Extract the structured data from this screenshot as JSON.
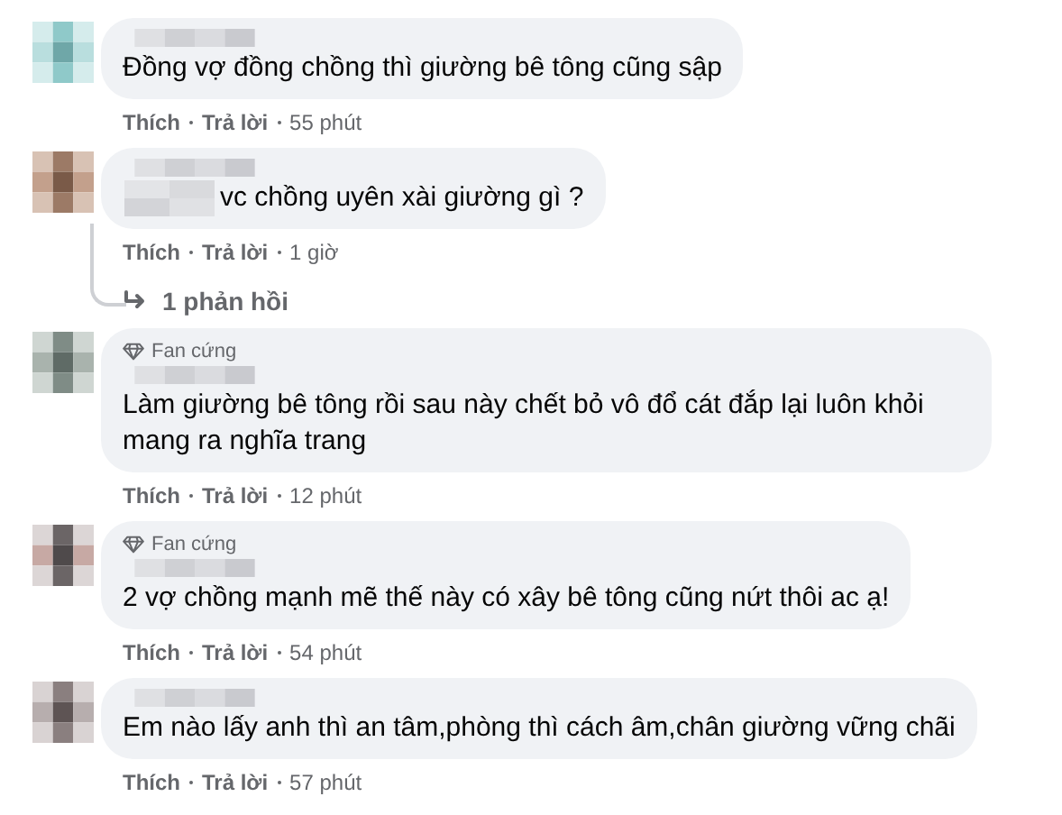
{
  "comments": [
    {
      "text": "Đồng vợ đồng chồng thì giường bê tông cũng sập",
      "text_blurred_prefix": false,
      "like": "Thích",
      "reply": "Trả lời",
      "time": "55 phút"
    },
    {
      "text": "vc chồng uyên xài giường gì ?",
      "text_blurred_prefix": true,
      "like": "Thích",
      "reply": "Trả lời",
      "time": "1 giờ",
      "replies": "1 phản hồi"
    },
    {
      "badge": "Fan cứng",
      "text": "Làm giường bê tông rồi sau này chết bỏ vô đổ cát đắp lại luôn khỏi mang ra nghĩa trang",
      "text_blurred_prefix": false,
      "like": "Thích",
      "reply": "Trả lời",
      "time": "12 phút"
    },
    {
      "badge": "Fan cứng",
      "text": "2 vợ chồng mạnh mẽ thế này có xây bê tông cũng nứt thôi ac ạ!",
      "text_blurred_prefix": false,
      "like": "Thích",
      "reply": "Trả lời",
      "time": "54 phút"
    },
    {
      "text": "Em nào lấy anh thì an tâm,phòng thì cách âm,chân giường vững chãi",
      "text_blurred_prefix": false,
      "like": "Thích",
      "reply": "Trả lời",
      "time": "57 phút"
    }
  ]
}
